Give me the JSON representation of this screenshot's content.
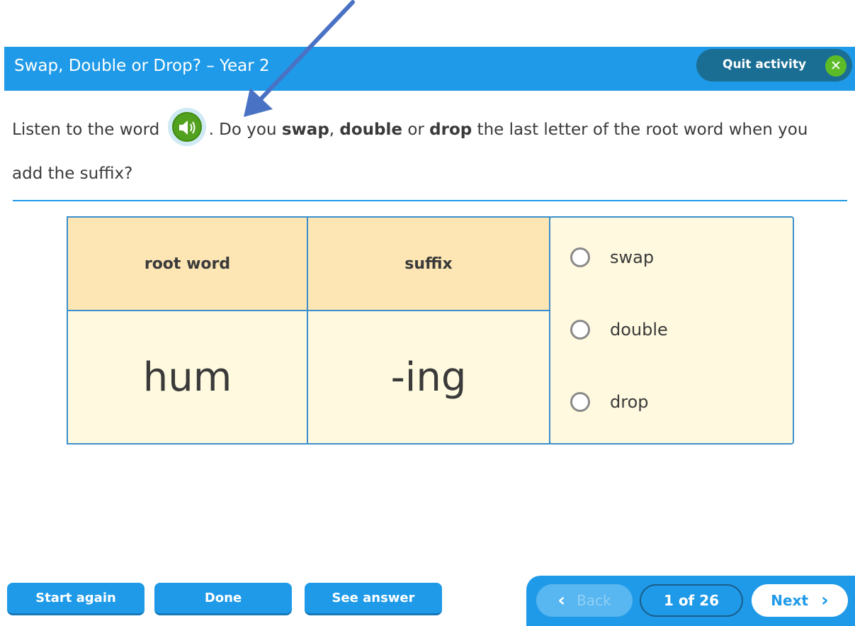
{
  "header": {
    "title": "Swap, Double or Drop? – Year 2",
    "quit_label": "Quit activity",
    "quit_icon": "close-icon"
  },
  "instruction": {
    "part1": "Listen to the word",
    "part2": ". Do you ",
    "swap": "swap",
    "comma": ", ",
    "double": "double",
    "or": " or ",
    "drop": "drop",
    "part3": " the last letter of the root word when you add the suffix?",
    "speaker_icon": "speaker-icon"
  },
  "table": {
    "root_header": "root word",
    "suffix_header": "suffix",
    "root_value": "hum",
    "suffix_value": "-ing"
  },
  "options": [
    {
      "label": "swap"
    },
    {
      "label": "double"
    },
    {
      "label": "drop"
    }
  ],
  "buttons": {
    "start_again": "Start again",
    "done": "Done",
    "see_answer": "See answer"
  },
  "nav": {
    "back": "Back",
    "page": "1 of 26",
    "next": "Next"
  },
  "colors": {
    "accent": "#1f9ae8",
    "quit_bg": "#1a6e93",
    "green": "#5cbc28",
    "table_head": "#fde6b4",
    "table_body": "#fff9df",
    "arrow": "#4a72c4"
  }
}
